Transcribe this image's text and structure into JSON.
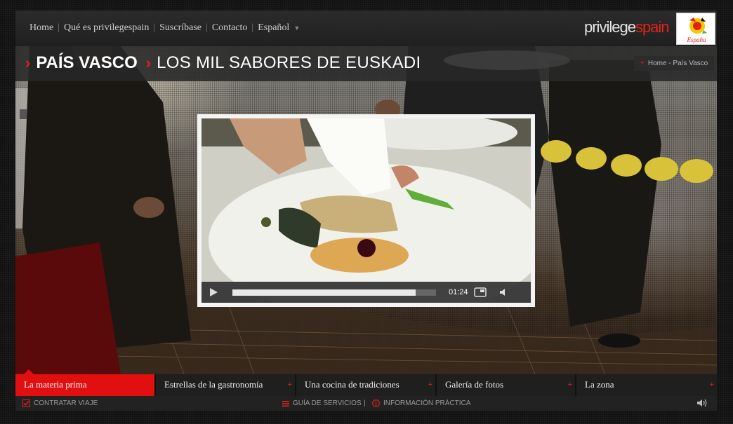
{
  "nav": {
    "items": [
      "Home",
      "Qué es privilegespain",
      "Suscríbase",
      "Contacto"
    ],
    "language": "Español"
  },
  "brand": {
    "part1": "privilege",
    "part2": "spain",
    "logo_text": "España"
  },
  "header": {
    "region": "PAÍS VASCO",
    "subtitle": "LOS MIL SABORES DE EUSKADI",
    "breadcrumb": "Home - País Vasco"
  },
  "video": {
    "time": "01:24",
    "progress": 0.9
  },
  "tabs": [
    {
      "label": "La materia prima",
      "active": true
    },
    {
      "label": "Estrellas de la gastronomía",
      "active": false
    },
    {
      "label": "Una cocina de tradiciones",
      "active": false
    },
    {
      "label": "Galería de fotos",
      "active": false
    },
    {
      "label": "La zona",
      "active": false
    }
  ],
  "footer": {
    "contratar": "CONTRATAR VIAJE",
    "guia": "GUÍA DE SERVICIOS",
    "separator": "|",
    "info": "INFORMACIÓN PRÁCTICA"
  },
  "colors": {
    "accent": "#e32119",
    "active_tab": "#e10f0f"
  }
}
